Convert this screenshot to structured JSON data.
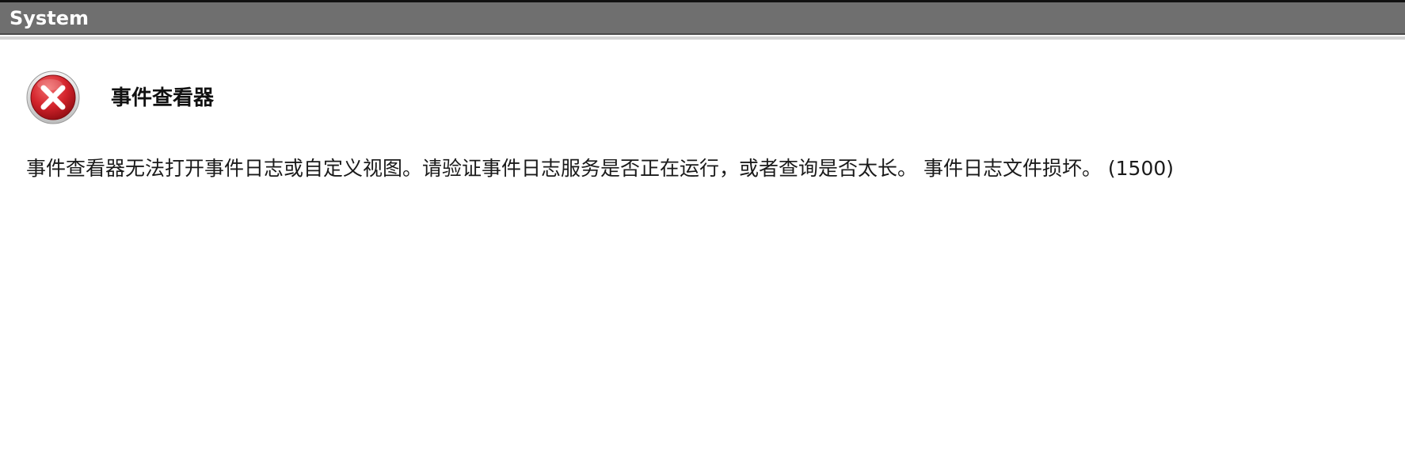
{
  "window": {
    "title": "System"
  },
  "dialog": {
    "icon": "error-icon",
    "heading": "事件查看器",
    "message": "事件查看器无法打开事件日志或自定义视图。请验证事件日志服务是否正在运行，或者查询是否太长。 事件日志文件损坏。 (1500)"
  },
  "colors": {
    "title_bar": "#6f6f6f",
    "title_text": "#ffffff",
    "background": "#ffffff",
    "error_red": "#c8161e"
  }
}
